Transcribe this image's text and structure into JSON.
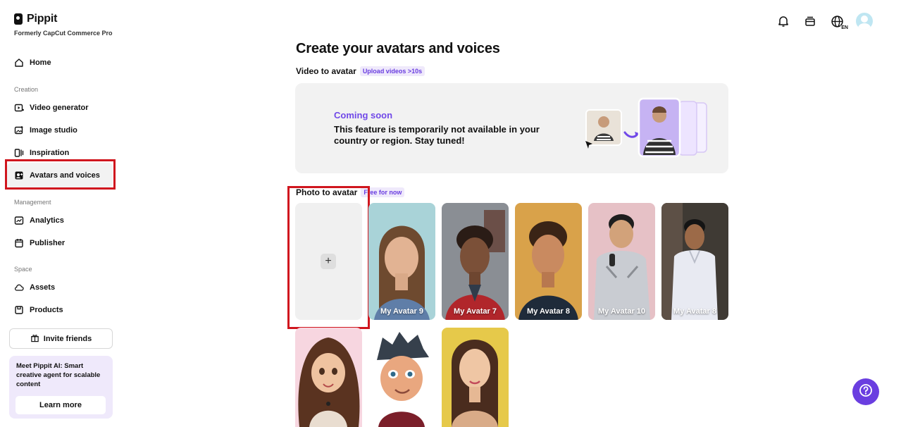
{
  "brand": {
    "name": "Pippit",
    "subtitle": "Formerly CapCut Commerce Pro"
  },
  "sidebar": {
    "home": "Home",
    "sections": {
      "creation": "Creation",
      "management": "Management",
      "space": "Space"
    },
    "creation_items": [
      {
        "label": "Video generator",
        "icon": "video-plus-icon"
      },
      {
        "label": "Image studio",
        "icon": "image-plus-icon"
      },
      {
        "label": "Inspiration",
        "icon": "inspiration-icon"
      },
      {
        "label": "Avatars and voices",
        "icon": "avatar-icon",
        "active": true
      }
    ],
    "management_items": [
      {
        "label": "Analytics",
        "icon": "analytics-icon"
      },
      {
        "label": "Publisher",
        "icon": "calendar-icon"
      }
    ],
    "space_items": [
      {
        "label": "Assets",
        "icon": "cloud-icon"
      },
      {
        "label": "Products",
        "icon": "box-icon"
      }
    ],
    "invite_label": "Invite friends",
    "promo_text": "Meet Pippit AI: Smart creative agent for scalable content",
    "learn_more": "Learn more"
  },
  "topbar": {
    "icons": [
      "bell-icon",
      "card-icon",
      "globe-icon",
      "user-avatar"
    ],
    "lang": "EN"
  },
  "main": {
    "title": "Create your avatars and voices",
    "video_to_avatar": {
      "label": "Video to avatar",
      "tag": "Upload videos >10s",
      "coming_title": "Coming soon",
      "coming_desc": "This feature is temporarily not available in your country or region. Stay tuned!"
    },
    "photo_to_avatar": {
      "label": "Photo to avatar",
      "tag": "Free for now",
      "avatars": [
        {
          "label": "My Avatar 9"
        },
        {
          "label": "My Avatar 7"
        },
        {
          "label": "My Avatar 8"
        },
        {
          "label": "My Avatar 10"
        },
        {
          "label": "My Avatar 8"
        },
        {
          "label": ""
        },
        {
          "label": ""
        },
        {
          "label": ""
        }
      ]
    }
  },
  "colors": {
    "accent": "#6a3ee0",
    "highlight": "#d0161e"
  }
}
